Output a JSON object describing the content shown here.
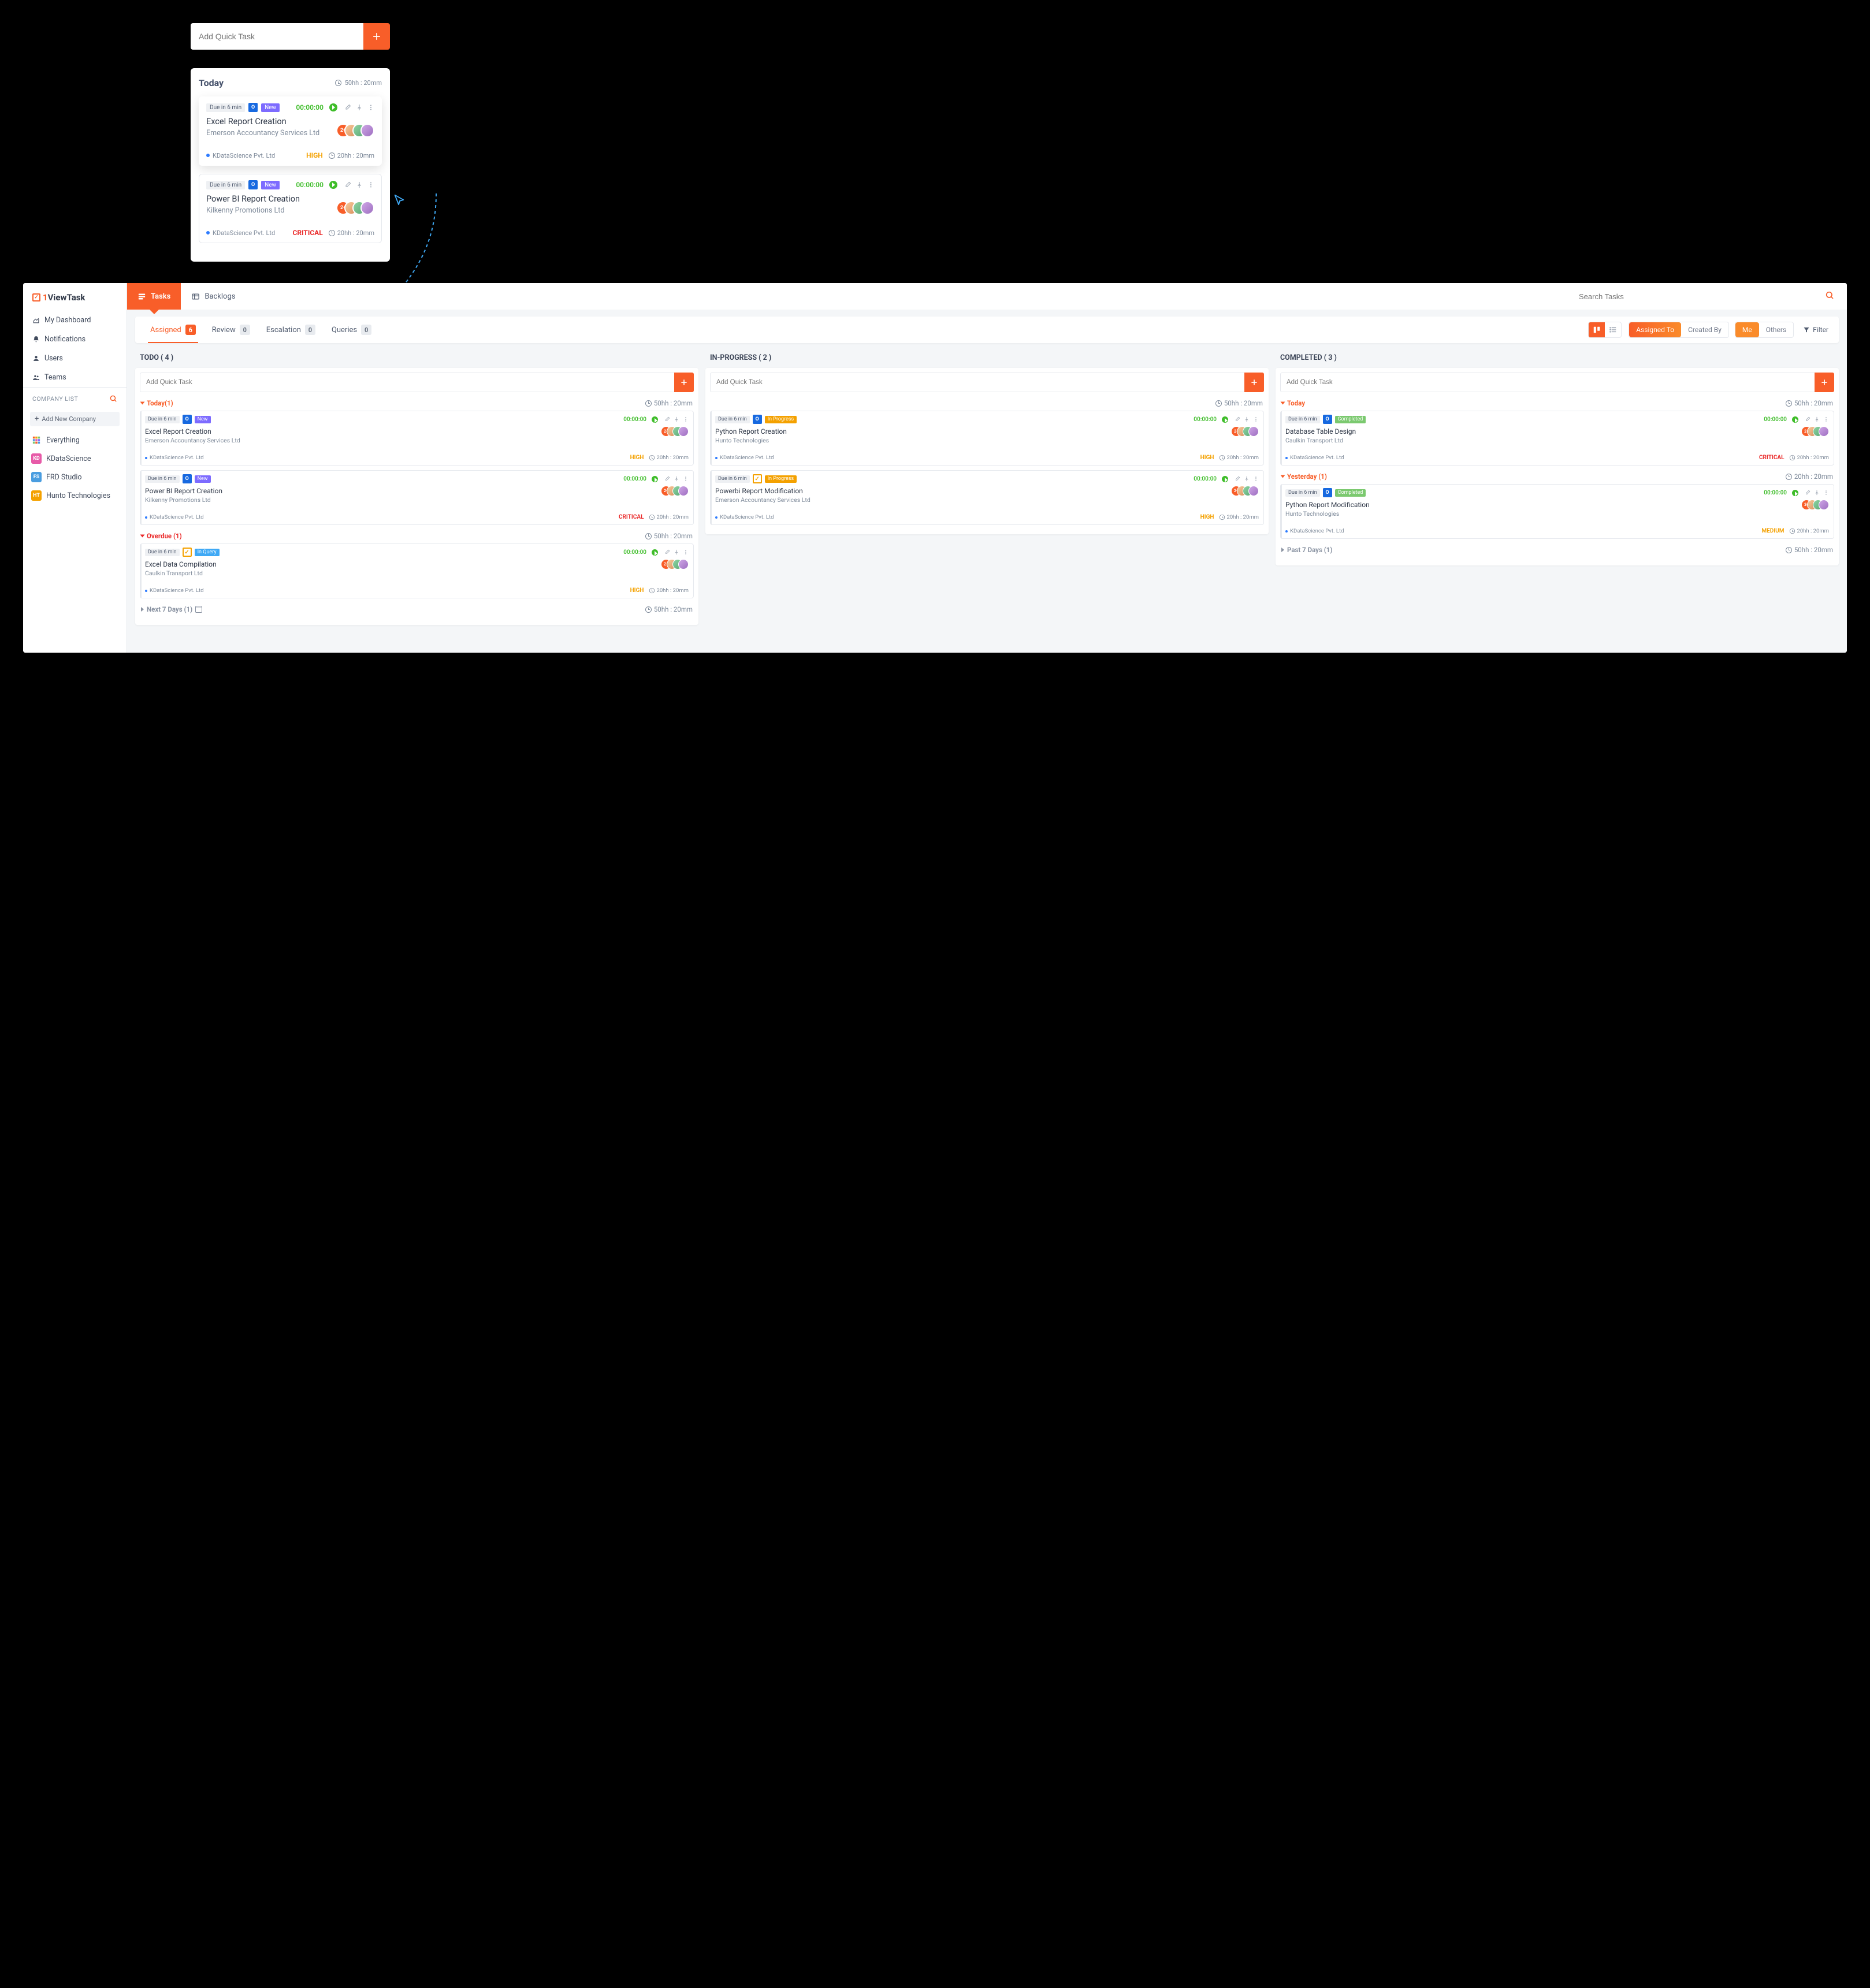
{
  "quickAdd": {
    "placeholder": "Add Quick Task"
  },
  "preview": {
    "header": {
      "title": "Today",
      "time": "50hh : 20mm"
    },
    "cards": [
      {
        "due": "Due in 6 min",
        "tag": "New",
        "tagClass": "new",
        "timer": "00:00:00",
        "title": "Excel Report Creation",
        "company": "Emerson Accountancy Services Ltd",
        "source": "KDataScience Pvt. Ltd",
        "prio": "HIGH",
        "prioClass": "prio-high",
        "footTime": "20hh : 20mm"
      },
      {
        "due": "Due in 6 min",
        "tag": "New",
        "tagClass": "new",
        "timer": "00:00:00",
        "title": "Power BI Report Creation",
        "company": "Kilkenny Promotions Ltd",
        "source": "KDataScience Pvt. Ltd",
        "prio": "CRITICAL",
        "prioClass": "prio-crit",
        "footTime": "20hh : 20mm"
      }
    ]
  },
  "brand": {
    "pre": "1",
    "name": "ViewTask"
  },
  "sidebar": {
    "nav": [
      {
        "label": "My Dashboard"
      },
      {
        "label": "Notifications"
      },
      {
        "label": "Users"
      },
      {
        "label": "Teams"
      }
    ],
    "companyHeader": "COMPANY LIST",
    "addCompany": "Add New Company",
    "companies": [
      {
        "label": "Everything",
        "badgeBg": "grid"
      },
      {
        "label": "KDataScience",
        "badge": "KD",
        "badgeBg": "#e75aa8"
      },
      {
        "label": "FRD Studio",
        "badge": "FS",
        "badgeBg": "#4a9de0"
      },
      {
        "label": "Hunto Technologies",
        "badge": "HT",
        "badgeBg": "#f4a100"
      }
    ]
  },
  "topTabs": [
    {
      "label": "Tasks",
      "active": true
    },
    {
      "label": "Backlogs"
    }
  ],
  "search": {
    "placeholder": "Search Tasks"
  },
  "statusTabs": [
    {
      "label": "Assigned",
      "count": "6",
      "active": true
    },
    {
      "label": "Review",
      "count": "0"
    },
    {
      "label": "Escalation",
      "count": "0"
    },
    {
      "label": "Queries",
      "count": "0"
    }
  ],
  "roleTabs": {
    "assignedTo": "Assigned To",
    "createdBy": "Created By",
    "me": "Me",
    "others": "Others",
    "filter": "Filter"
  },
  "board": {
    "columns": [
      {
        "key": "todo",
        "header": "TODO ( 4 )",
        "quick": "Add Quick Task",
        "buckets": [
          {
            "label": "Today(1)",
            "tone": "orange-t",
            "triDown": true,
            "time": "50hh : 20mm",
            "tasks": [
              {
                "due": "Due in 6 min",
                "icon": "o",
                "tag": "New",
                "tagClass": "new",
                "timer": "00:00:00",
                "title": "Excel Report Creation",
                "sub": "Emerson Accountancy Services Ltd",
                "source": "KDataScience Pvt. Ltd",
                "prio": "HIGH",
                "prioClass": "prio-high",
                "footTime": "20hh : 20mm"
              },
              {
                "due": "Due in 6 min",
                "icon": "o",
                "tag": "New",
                "tagClass": "new",
                "timer": "00:00:00",
                "title": "Power BI Report Creation",
                "sub": "Kilkenny Promotions Ltd",
                "source": "KDataScience Pvt. Ltd",
                "prio": "CRITICAL",
                "prioClass": "prio-crit",
                "footTime": "20hh : 20mm"
              }
            ]
          },
          {
            "label": "Overdue (1)",
            "tone": "red-t",
            "triDown": true,
            "time": "50hh : 20mm",
            "tasks": [
              {
                "due": "Due in 6 min",
                "icon": "v",
                "tag": "In Query",
                "tagClass": "query",
                "timer": "00:00:00",
                "title": "Excel Data Compilation",
                "sub": "Caulkin Transport Ltd",
                "source": "KDataScience Pvt. Ltd",
                "prio": "HIGH",
                "prioClass": "prio-high",
                "footTime": "20hh : 20mm"
              }
            ]
          },
          {
            "label": "Next 7 Days (1)",
            "tone": "grey-t",
            "triDown": false,
            "extraIcon": "cal",
            "time": "50hh : 20mm"
          }
        ]
      },
      {
        "key": "inprogress",
        "header": "IN-PROGRESS ( 2 )",
        "quick": "Add Quick Task",
        "buckets": [
          {
            "noHeader": true,
            "time": "50hh : 20mm",
            "tasks": [
              {
                "due": "Due in 6 min",
                "icon": "o",
                "tag": "In Progress",
                "tagClass": "prog",
                "timer": "00:00:00",
                "title": "Python Report Creation",
                "sub": "Hunto Technologies",
                "source": "KDataScience Pvt. Ltd",
                "prio": "HIGH",
                "prioClass": "prio-high",
                "footTime": "20hh : 20mm"
              },
              {
                "due": "Due in 6 min",
                "icon": "v",
                "tag": "In Progress",
                "tagClass": "prog",
                "timer": "00:00:00",
                "title": "Powerbi Report Modification",
                "sub": "Emerson Accountancy Services Ltd",
                "source": "KDataScience Pvt. Ltd",
                "prio": "HIGH",
                "prioClass": "prio-high",
                "footTime": "20hh : 20mm"
              }
            ]
          }
        ]
      },
      {
        "key": "completed",
        "header": "COMPLETED ( 3 )",
        "quick": "Add Quick Task",
        "buckets": [
          {
            "label": "Today",
            "tone": "orange-t",
            "triDown": true,
            "time": "50hh : 20mm",
            "tasks": [
              {
                "due": "Due in 6 min",
                "icon": "o",
                "tag": "Completed",
                "tagClass": "done",
                "timer": "00:00:00",
                "title": "Database Table Design",
                "sub": "Caulkin Transport Ltd",
                "source": "KDataScience Pvt. Ltd",
                "prio": "CRITICAL",
                "prioClass": "prio-crit",
                "footTime": "20hh : 20mm"
              }
            ]
          },
          {
            "label": "Yesterday (1)",
            "tone": "orange-t",
            "triDown": true,
            "time": "20hh : 20mm",
            "tasks": [
              {
                "due": "Due in 6 min",
                "icon": "o",
                "tag": "Completed",
                "tagClass": "done",
                "timer": "00:00:00",
                "title": "Python Report Modification",
                "sub": "Hunto Technologies",
                "source": "KDataScience Pvt. Ltd",
                "prio": "MEDIUM",
                "prioClass": "prio-med",
                "footTime": "20hh : 20mm"
              }
            ]
          },
          {
            "label": "Past 7 Days (1)",
            "tone": "grey-t",
            "triDown": false,
            "time": "50hh : 20mm"
          }
        ]
      }
    ]
  }
}
